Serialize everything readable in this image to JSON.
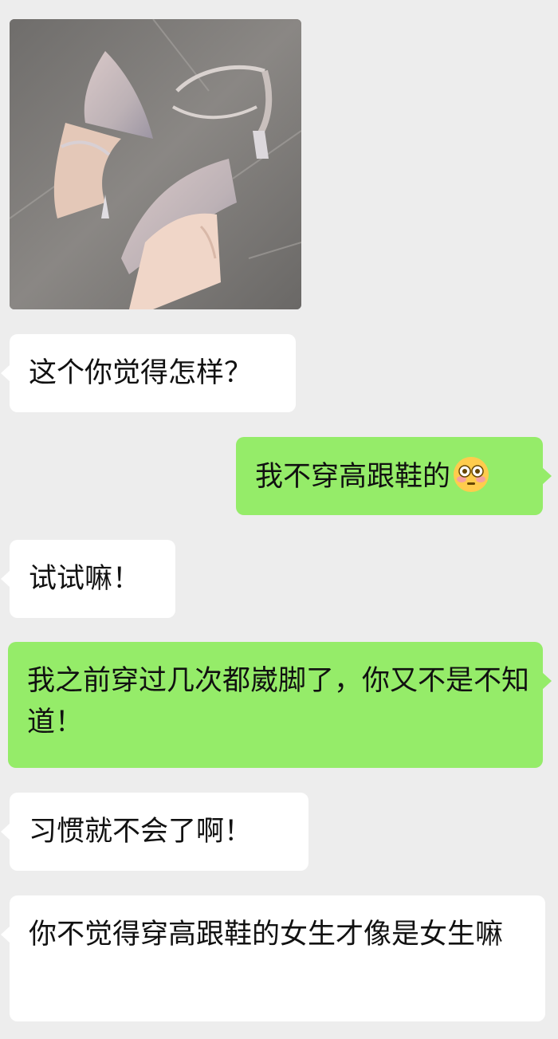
{
  "chat": {
    "image": {
      "description_icon": "product-photo-icon"
    },
    "messages": [
      {
        "side": "left",
        "text": "这个你觉得怎样？"
      },
      {
        "side": "right",
        "text": "我不穿高跟鞋的",
        "emoji": "flushed-face-icon"
      },
      {
        "side": "left",
        "text": "试试嘛！"
      },
      {
        "side": "right",
        "text": "我之前穿过几次都崴脚了，你又不是不知道！"
      },
      {
        "side": "left",
        "text": "习惯就不会了啊！"
      },
      {
        "side": "left",
        "text": "你不觉得穿高跟鞋的女生才像是女生嘛"
      }
    ]
  },
  "colors": {
    "background": "#ededed",
    "incoming_bubble": "#ffffff",
    "outgoing_bubble": "#95ec69"
  }
}
